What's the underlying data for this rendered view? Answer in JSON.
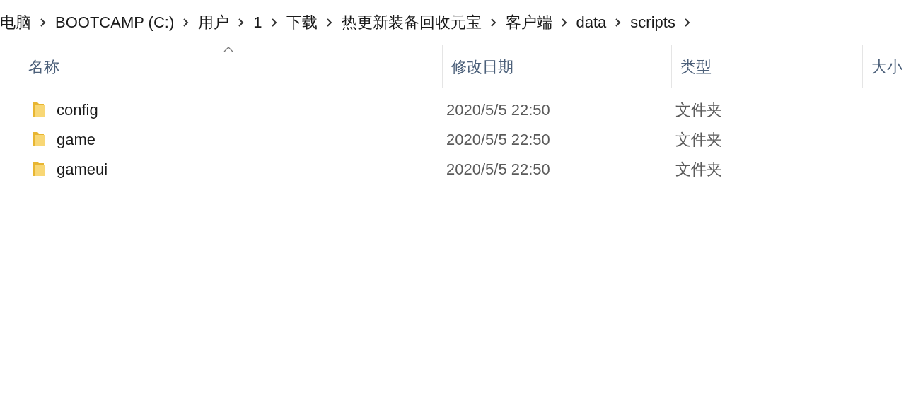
{
  "breadcrumb": [
    "电脑",
    "BOOTCAMP (C:)",
    "用户",
    "1",
    "下载",
    "热更新装备回收元宝",
    "客户端",
    "data",
    "scripts"
  ],
  "columns": [
    {
      "label": "名称",
      "sorted": true
    },
    {
      "label": "修改日期",
      "sorted": false
    },
    {
      "label": "类型",
      "sorted": false
    },
    {
      "label": "大小",
      "sorted": false
    }
  ],
  "rows": [
    {
      "name": "config",
      "modified": "2020/5/5 22:50",
      "type": "文件夹"
    },
    {
      "name": "game",
      "modified": "2020/5/5 22:50",
      "type": "文件夹"
    },
    {
      "name": "gameui",
      "modified": "2020/5/5 22:50",
      "type": "文件夹"
    }
  ]
}
